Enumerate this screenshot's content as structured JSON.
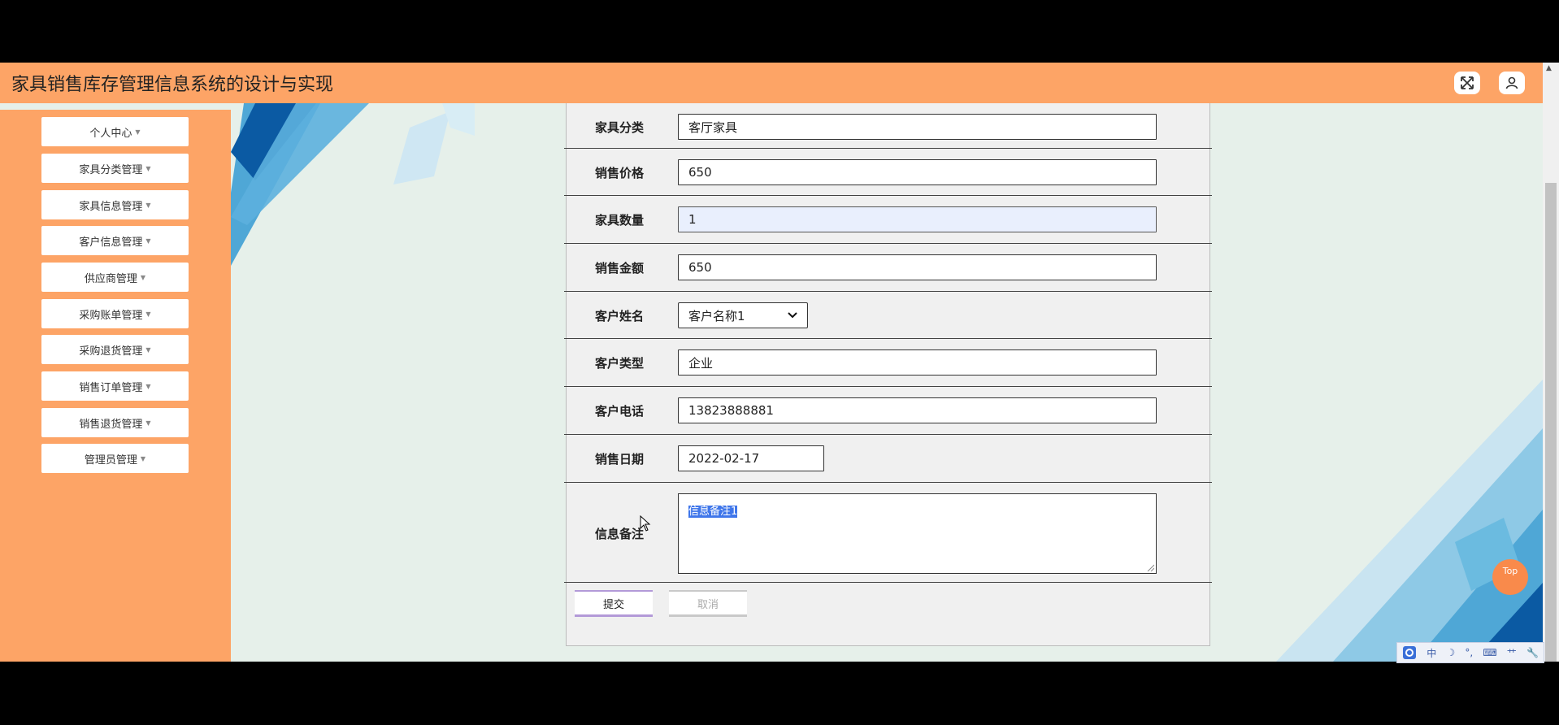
{
  "header": {
    "title": "家具销售库存管理信息系统的设计与实现"
  },
  "icons": {
    "expand": "expand-arrows-icon",
    "user": "user-icon"
  },
  "colors": {
    "header": "#fda466",
    "sidebar": "#fda466",
    "selection": "#3f76ea"
  },
  "sidebar": {
    "items": [
      {
        "label": "个人中心"
      },
      {
        "label": "家具分类管理"
      },
      {
        "label": "家具信息管理"
      },
      {
        "label": "客户信息管理"
      },
      {
        "label": "供应商管理"
      },
      {
        "label": "采购账单管理"
      },
      {
        "label": "采购退货管理"
      },
      {
        "label": "销售订单管理"
      },
      {
        "label": "销售退货管理"
      },
      {
        "label": "管理员管理"
      }
    ]
  },
  "form": {
    "category": {
      "label": "家具分类",
      "value": "客厅家具"
    },
    "price": {
      "label": "销售价格",
      "value": "650"
    },
    "quantity": {
      "label": "家具数量",
      "value": "1"
    },
    "amount": {
      "label": "销售金额",
      "value": "650"
    },
    "customer_name": {
      "label": "客户姓名",
      "value": "客户名称1"
    },
    "customer_type": {
      "label": "客户类型",
      "value": "企业"
    },
    "customer_phone": {
      "label": "客户电话",
      "value": "13823888881"
    },
    "sale_date": {
      "label": "销售日期",
      "value": "2022-02-17"
    },
    "remark": {
      "label": "信息备注",
      "value": "信息备注1"
    },
    "submit_label": "提交",
    "cancel_label": "取消"
  },
  "top_button": {
    "label": "Top"
  },
  "ime": {
    "lang": "中",
    "moon": "☽",
    "punct": "°,",
    "keyboard": "⌨",
    "sep": "⺾",
    "tool": "🔧"
  }
}
